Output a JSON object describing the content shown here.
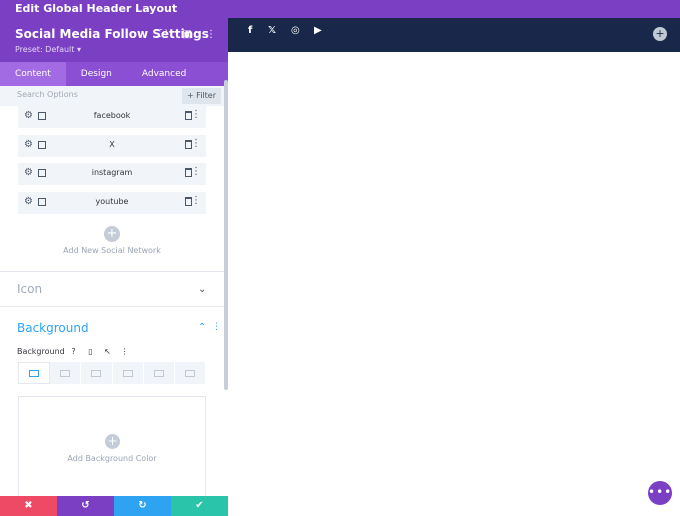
{
  "topbar": {
    "title": "Edit Global Header Layout"
  },
  "panel": {
    "title": "Social Media Follow Settings",
    "preset": "Preset: Default ▾",
    "tabs": [
      {
        "label": "Content",
        "active": true
      },
      {
        "label": "Design",
        "active": false
      },
      {
        "label": "Advanced",
        "active": false
      }
    ],
    "search_placeholder": "Search Options",
    "filter_label": "+ Filter",
    "networks": [
      {
        "label": "facebook"
      },
      {
        "label": "X"
      },
      {
        "label": "instagram"
      },
      {
        "label": "youtube"
      }
    ],
    "add_network_label": "Add New Social Network",
    "icon_section": "Icon",
    "background_section": "Background",
    "background_label": "Background",
    "add_bg_color_label": "Add Background Color"
  },
  "footer": {
    "cancel": "✖",
    "undo": "↺",
    "redo": "↻",
    "save": "✔"
  },
  "colors": {
    "accent": "#7b3fc4",
    "preview_bar": "#19284a",
    "link_blue": "#2ea3f2"
  },
  "preview": {
    "social_icons": [
      "f",
      "𝕏",
      "◎",
      "▶"
    ]
  }
}
